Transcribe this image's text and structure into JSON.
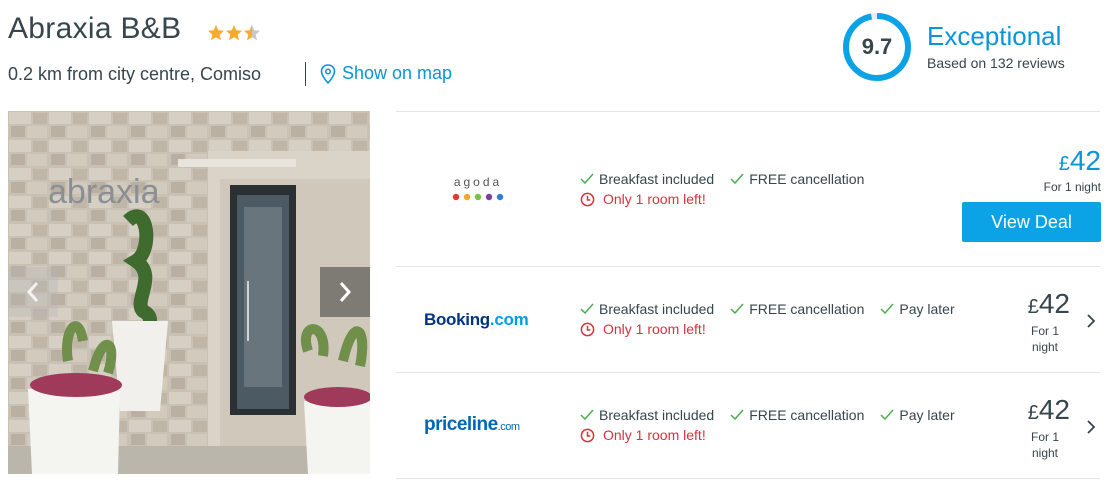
{
  "hotel": {
    "name": "Abraxia B&B",
    "stars": 3.5,
    "distance_text": "0.2 km from city centre, Comiso",
    "map_link": "Show on map"
  },
  "rating": {
    "score": "9.7",
    "word": "Exceptional",
    "reviews": "Based on 132 reviews",
    "score_fraction": 0.97
  },
  "photo": {
    "sign_text": "abraxia"
  },
  "deals": [
    {
      "provider": "agoda",
      "features": [
        "Breakfast included",
        "FREE cancellation"
      ],
      "warning": "Only 1 room left!",
      "currency": "£",
      "price": "42",
      "per_night": "For 1 night",
      "button": "View Deal"
    },
    {
      "provider_main": "Booking",
      "provider_tld": ".com",
      "features": [
        "Breakfast included",
        "FREE cancellation",
        "Pay later"
      ],
      "warning": "Only 1 room left!",
      "currency": "£",
      "price": "42",
      "per_night_1": "For 1",
      "per_night_2": "night"
    },
    {
      "provider_main": "priceline",
      "provider_tld": ".com",
      "features": [
        "Breakfast included",
        "FREE cancellation",
        "Pay later"
      ],
      "warning": "Only 1 room left!",
      "currency": "£",
      "price": "42",
      "per_night_1": "For 1",
      "per_night_2": "night"
    }
  ],
  "colors": {
    "accent": "#0b95d9",
    "button": "#0ba3e6",
    "warning": "#d8323c",
    "check": "#4caf50",
    "star": "#f6ab2f"
  }
}
